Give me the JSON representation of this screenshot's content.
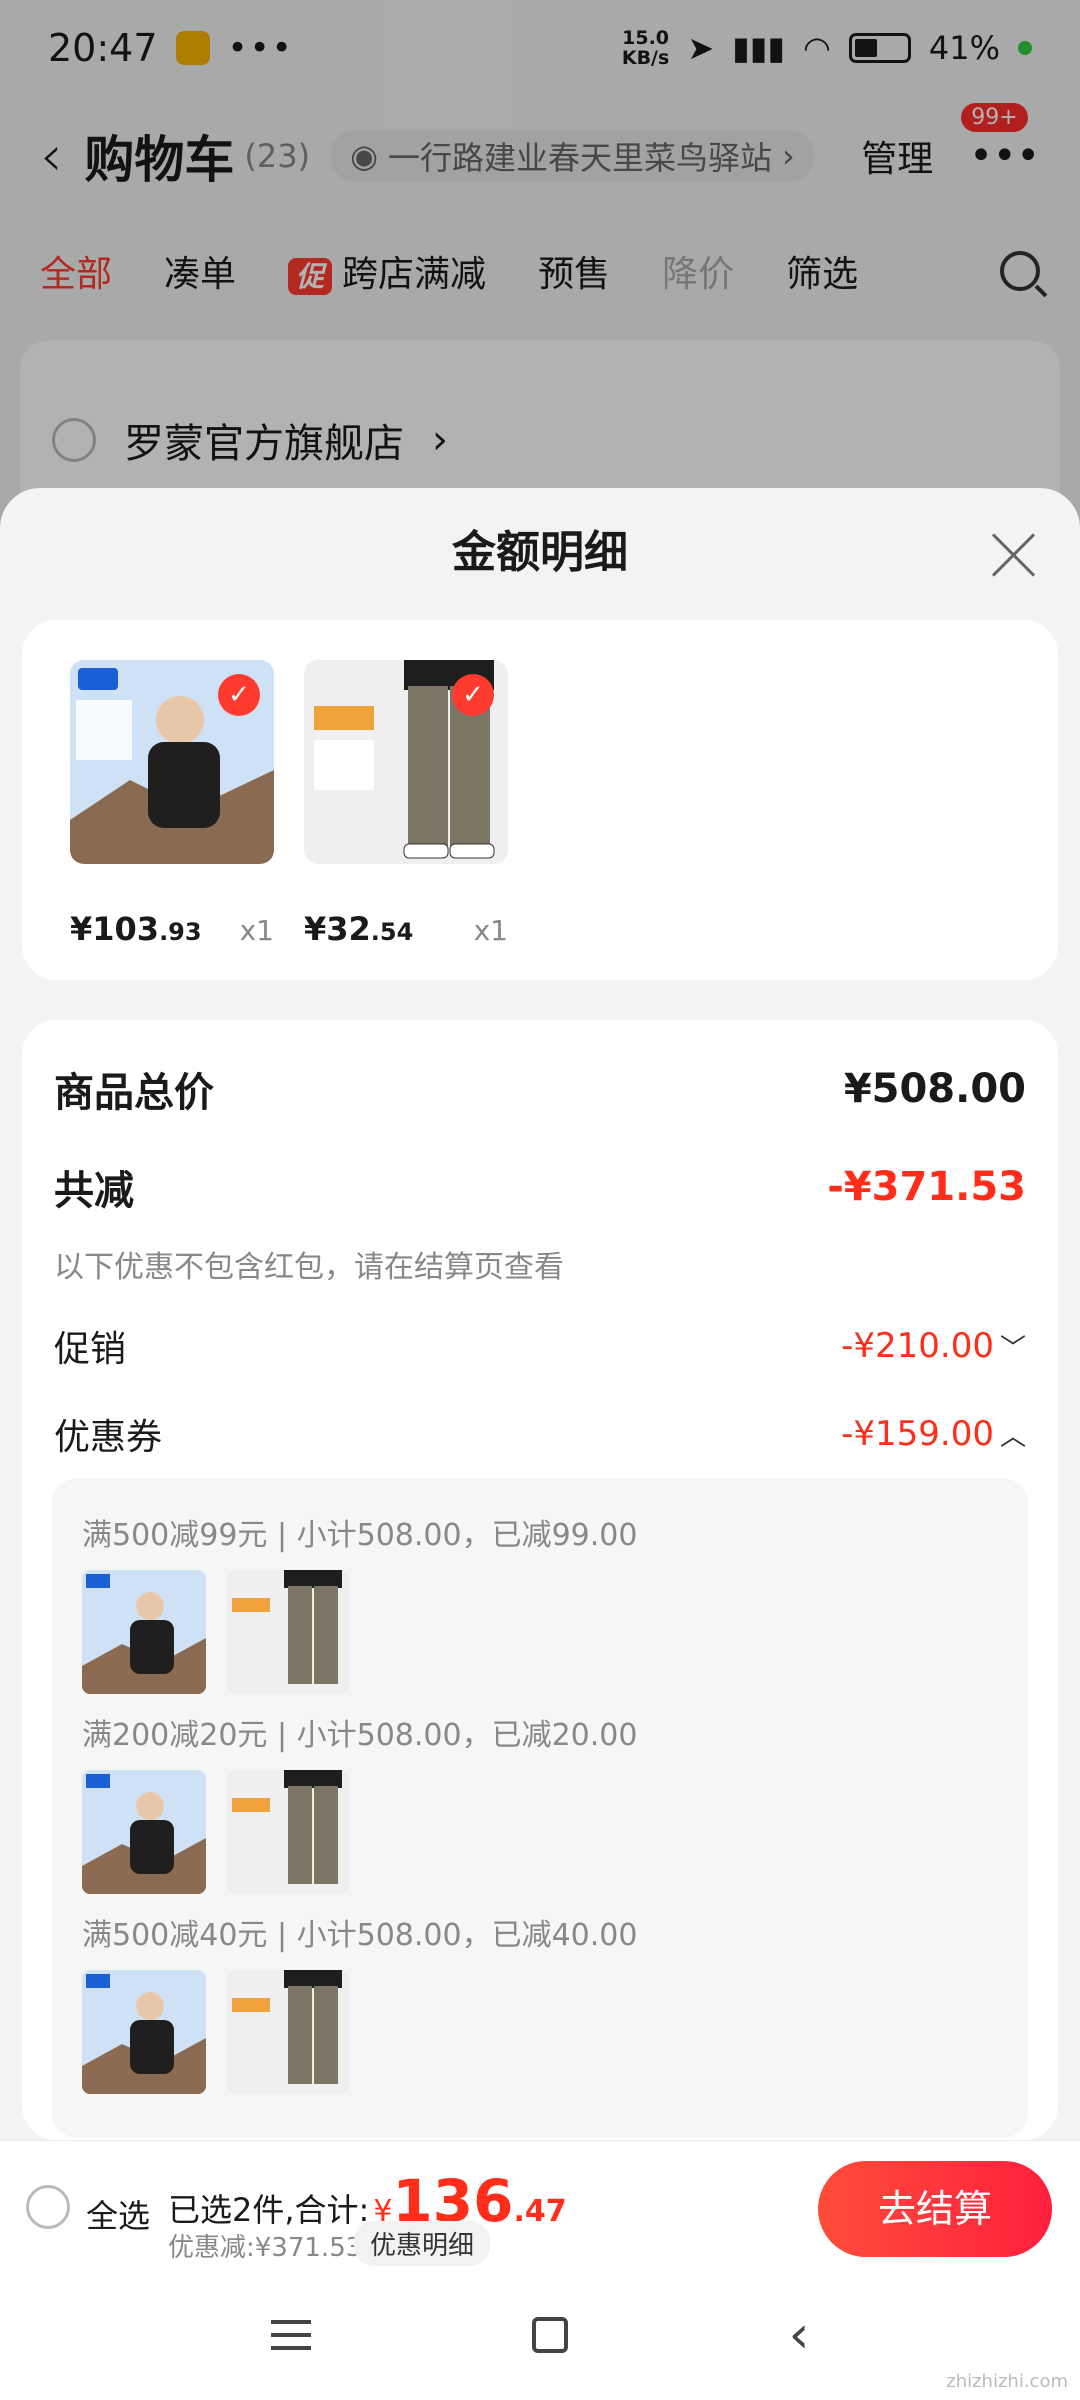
{
  "status_bar": {
    "time": "20:47",
    "speed": "15.0",
    "speed_unit": "KB/s",
    "battery": "41%"
  },
  "cart": {
    "title": "购物车",
    "count": "(23)",
    "address": "一行路建业春天里菜鸟驿站",
    "manage": "管理",
    "badge": "99+"
  },
  "tabs": [
    "全部",
    "凑单",
    "跨店满减",
    "预售",
    "降价",
    "筛选"
  ],
  "promo_chip": "促",
  "store": {
    "name": "罗蒙官方旗舰店"
  },
  "sheet": {
    "title": "金额明细",
    "products": [
      {
        "image": "down-jacket",
        "price_main": "¥103",
        "price_cents": ".93",
        "qty": "x1"
      },
      {
        "image": "pants",
        "price_main": "¥32",
        "price_cents": ".54",
        "qty": "x1"
      }
    ],
    "total_label": "商品总价",
    "total_value": "¥508.00",
    "reduce_label": "共减",
    "reduce_value": "-¥371.53",
    "reduce_note": "以下优惠不包含红包，请在结算页查看",
    "promo_label": "促销",
    "promo_value": "-¥210.00",
    "coupon_label": "优惠券",
    "coupon_value": "-¥159.00",
    "coupon_rows": [
      {
        "text": "满500减99元 | 小计508.00，已减99.00"
      },
      {
        "text": "满200减20元 | 小计508.00，已减20.00"
      },
      {
        "text": "满500减40元 | 小计508.00，已减40.00"
      }
    ]
  },
  "bottom": {
    "select_all": "全选",
    "summary": "已选2件,合计:",
    "currency": "¥",
    "total_int": "136",
    "total_dec": ".47",
    "saving": "优惠减:¥371.53",
    "detail_chip": "优惠明细",
    "checkout": "去结算"
  },
  "watermark": "zhizhizhi.com",
  "colors": {
    "accent": "#ff2d1a",
    "sheet_bg": "#f3f3f3"
  }
}
